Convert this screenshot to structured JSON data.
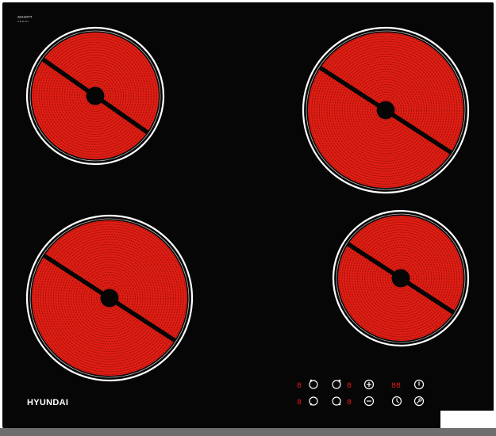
{
  "product": {
    "brand": "HYUNDAI",
    "glass_brand": "SCHOTT",
    "glass_line": "CERAN"
  },
  "colors": {
    "glass": "#060606",
    "element": "#e01e14",
    "element_groove": "#7a0c08",
    "ring": "#ffffff",
    "display": "#e21b1b",
    "touch_icon": "#ffffff"
  },
  "zones": [
    {
      "id": "zone-front-left-small",
      "label": "rear-left burner"
    },
    {
      "id": "zone-rear-right-large",
      "label": "rear-right burner"
    },
    {
      "id": "zone-front-left-large",
      "label": "front-left burner"
    },
    {
      "id": "zone-front-right-medium",
      "label": "front-right burner"
    }
  ],
  "controls": {
    "row1": [
      {
        "name": "zone1-display",
        "type": "display",
        "text": "8"
      },
      {
        "name": "zone1-select",
        "icon": "zone-select-icon"
      },
      {
        "name": "zone2-select",
        "icon": "zone-select-icon"
      },
      {
        "name": "zone2-display",
        "type": "display",
        "text": "8"
      },
      {
        "name": "plus-button",
        "icon": "plus-icon"
      },
      {
        "name": "timer-display",
        "type": "display",
        "text": "88"
      },
      {
        "name": "power-button",
        "icon": "power-icon"
      }
    ],
    "row2": [
      {
        "name": "zone3-display",
        "type": "display",
        "text": "8"
      },
      {
        "name": "zone3-select",
        "icon": "zone-select-icon"
      },
      {
        "name": "zone4-select",
        "icon": "zone-select-icon"
      },
      {
        "name": "zone4-display",
        "type": "display",
        "text": "8"
      },
      {
        "name": "minus-button",
        "icon": "minus-icon"
      },
      {
        "name": "timer-button",
        "icon": "clock-icon"
      },
      {
        "name": "lock-button",
        "icon": "key-lock-icon"
      }
    ]
  }
}
